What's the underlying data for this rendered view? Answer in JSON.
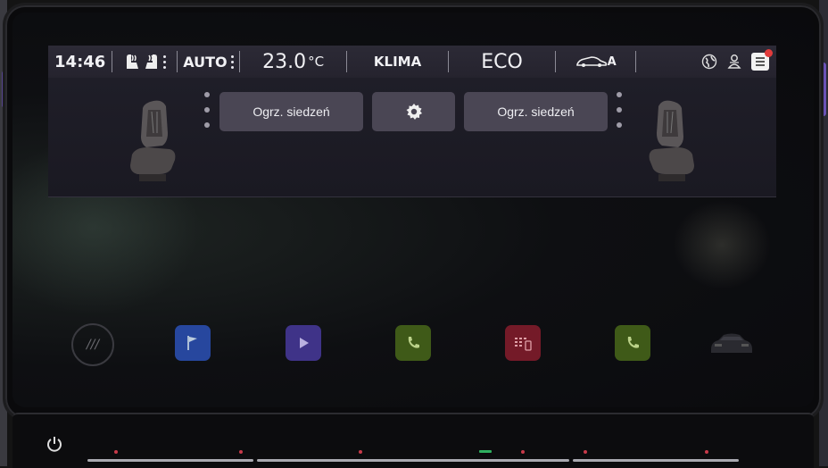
{
  "status_bar": {
    "time": "14:46",
    "seat_icon": "seat-heating-icon",
    "auto_label": "AUTO",
    "temperature_value": "23.0",
    "temperature_unit": "°C",
    "climate_label": "KLIMA",
    "mode_label": "ECO",
    "car_suffix": "A",
    "icons": [
      "globe-icon",
      "profile-icon",
      "notification-icon"
    ]
  },
  "seat_panel": {
    "left_button_label": "Ogrz. siedzeń",
    "settings_icon": "gear-icon",
    "right_button_label": "Ogrz. siedzeń"
  },
  "dock": {
    "items": [
      {
        "icon": "menu-icon",
        "color": "#2a2a2e"
      },
      {
        "icon": "flag-icon",
        "color": "#2c4fb8"
      },
      {
        "icon": "play-icon",
        "color": "#4a3a9a"
      },
      {
        "icon": "phone-icon",
        "color": "#4a6a1a"
      },
      {
        "icon": "phone-keypad-icon",
        "color": "#8a2030"
      },
      {
        "icon": "phone-icon",
        "color": "#4a6a1a"
      },
      {
        "icon": "car-icon",
        "color": "#1a1a1e"
      }
    ]
  },
  "colors": {
    "status_bar_bg": "#2c2a36",
    "button_bg": "#4a4654",
    "badge": "#e23b3b"
  }
}
